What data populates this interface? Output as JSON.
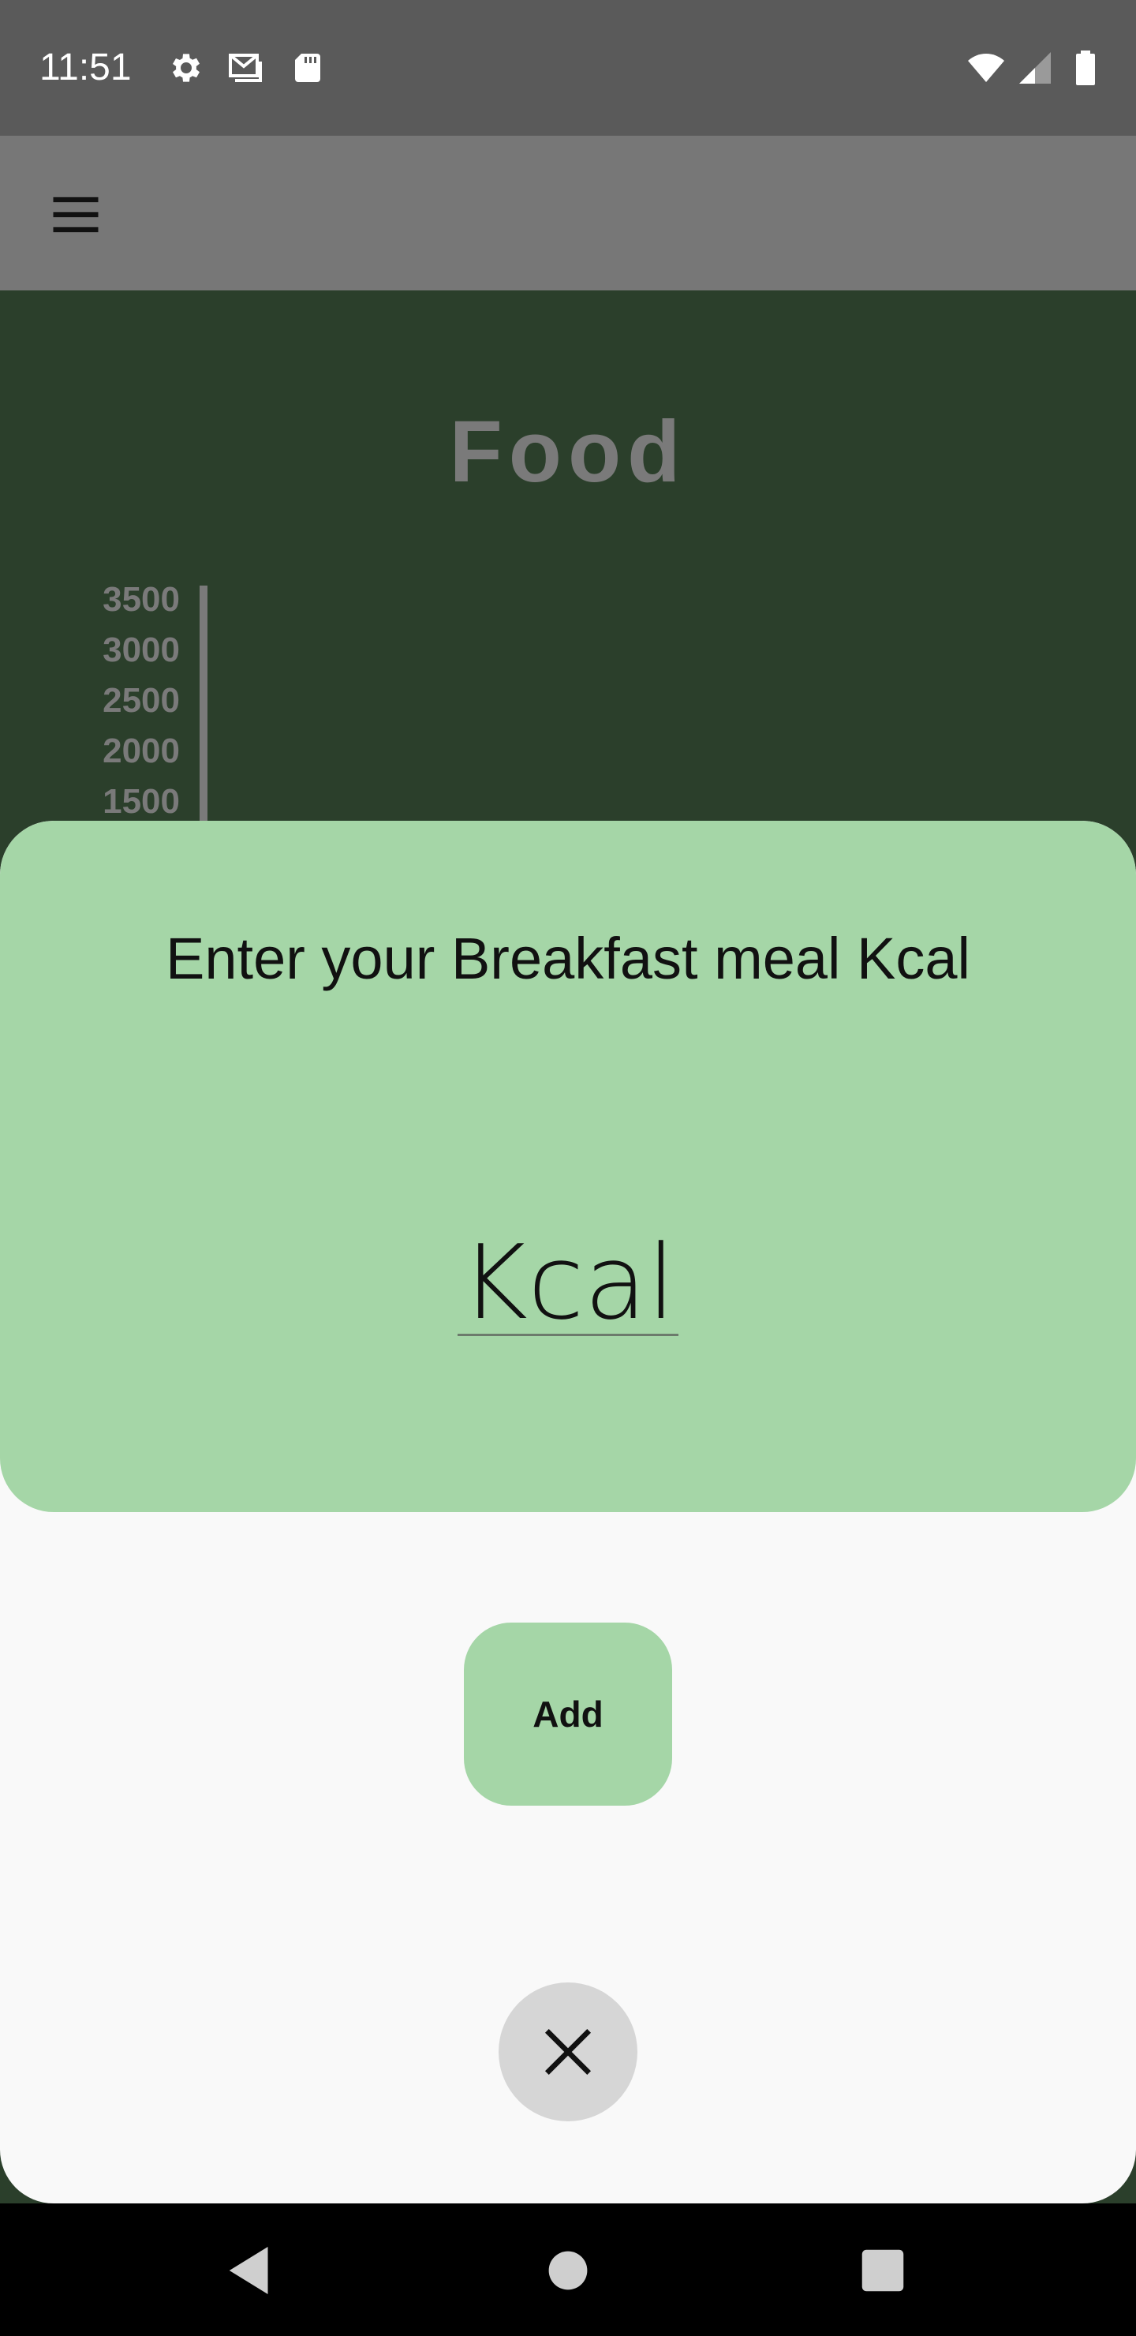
{
  "status_bar": {
    "time": "11:51",
    "icons": [
      "settings-icon",
      "gmail-icon",
      "sd-card-icon",
      "wifi-icon",
      "signal-icon",
      "battery-icon"
    ]
  },
  "app_bar": {
    "menu_icon": "menu-icon"
  },
  "background": {
    "page_title": "Food",
    "chart_data": {
      "type": "bar",
      "y_ticks": [
        "3500",
        "3000",
        "2500",
        "2000",
        "1500"
      ],
      "ylim": [
        1500,
        3500
      ]
    }
  },
  "dialog": {
    "prompt": "Enter your Breakfast meal Kcal",
    "input_placeholder": "Kcal",
    "add_label": "Add",
    "close_icon": "close-icon"
  },
  "colors": {
    "sheet_green": "#a5d6a7",
    "sheet_background": "#f9f9f9",
    "page_background": "#2b3f2b",
    "app_bar": "#777777",
    "status_bar": "#5a5a5a"
  },
  "nav_bar": {
    "icons": [
      "back-icon",
      "home-icon",
      "recents-icon"
    ]
  }
}
